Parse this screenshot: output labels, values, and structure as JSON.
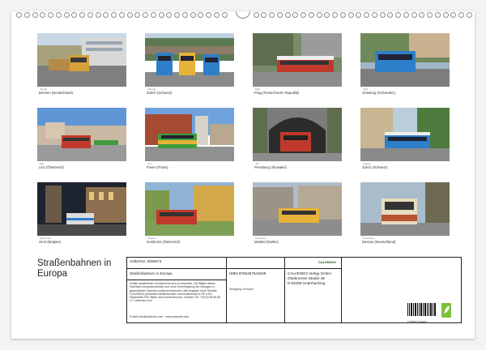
{
  "calendar": {
    "title_line1": "Straßenbahnen in",
    "title_line2": "Europa",
    "months": [
      {
        "month": "Januar",
        "caption": "Bremen (Deutschland)"
      },
      {
        "month": "Februar",
        "caption": "Zürich (Schweiz)"
      },
      {
        "month": "März",
        "caption": "Prag (Tschechische Republik)"
      },
      {
        "month": "April",
        "caption": "Göteborg (Schweden)"
      },
      {
        "month": "Mai",
        "caption": "Linz (Österreich)"
      },
      {
        "month": "Juni",
        "caption": "Posen (Polen)"
      },
      {
        "month": "Juli",
        "caption": "Pressburg (Slowakei)"
      },
      {
        "month": "August",
        "caption": "Zürich (Schweiz)"
      },
      {
        "month": "September",
        "caption": "Gent (Belgien)"
      },
      {
        "month": "Oktober",
        "caption": "Innsbruck (Österreich)"
      },
      {
        "month": "November",
        "caption": "Mailand (Italien)"
      },
      {
        "month": "Dezember",
        "caption": "Dessau (Deutschland)"
      }
    ]
  },
  "info": {
    "article_label": "Artikel-Nr. 2009074",
    "subtitle": "Straßenbahnen in Europa",
    "legal_text": "Inhalte bestehender Schutzrechte sind zu beachten. Die Blätter dieses Kalenders herauszunehmen und ohne Genehmigung des Verlages zu gewerblichen Zwecken weiterzuverwenden. Alle Angaben ohne Gewähr. CALVENDO produziert klimafreundlich und klimaneutral in DE & EU. Papierwahl FSC-Bilanz laut Kundenwunsch. Kontakt: Tel: +49 (0) 89 65 88 17 / calvendo.com",
    "email_line": "E-Mail: info@calvendo.com · www.calvendo.com",
    "isbn": "ISBN 9783457944929",
    "author": "Wolfgang Gerstner",
    "publisher_line1": "CALVENDO Verlag GmbH",
    "publisher_line2": "Ottobrunner Straße 39",
    "publisher_line3": "D-82008 Unterhaching",
    "barcode_digits": "9 783457 944929",
    "logo_text": "CALVENDO"
  },
  "colors": {
    "tram_red": "#c0392b",
    "tram_blue": "#2e7fc9",
    "tram_yellow": "#e5b23a",
    "tram_green": "#3f9e3b"
  }
}
